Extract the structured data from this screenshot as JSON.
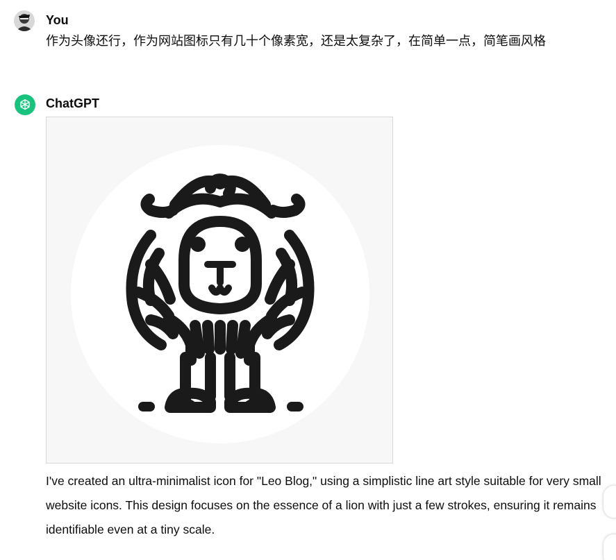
{
  "user_message": {
    "author": "You",
    "text": "作为头像还行，作为网站图标只有几十个像素宽，还是太复杂了，在简单一点，简笔画风格"
  },
  "assistant_message": {
    "author": "ChatGPT",
    "image_description": "lion-line-art-icon",
    "text": "I've created an ultra-minimalist icon for \"Leo Blog,\" using a simplistic line art style suitable for very small website icons. This design focuses on the essence of a lion with just a few strokes, ensuring it remains identifiable even at a tiny scale."
  },
  "colors": {
    "gpt_avatar": "#19c37d",
    "icon_stroke": "#1a1a1a",
    "image_background": "#f7f7f7"
  }
}
